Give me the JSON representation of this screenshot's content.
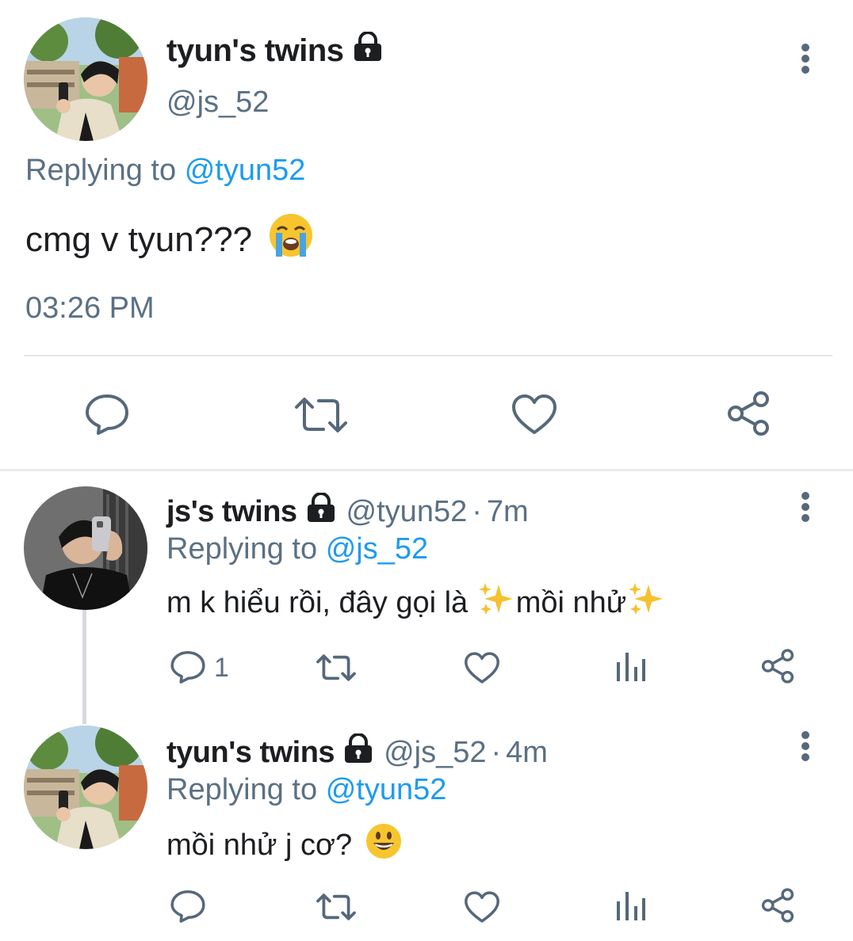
{
  "main_tweet": {
    "name": "tyun's twins",
    "handle": "@js_52",
    "replying_prefix": "Replying to",
    "replying_to": "@tyun52",
    "text": "cmg v tyun???",
    "emoji": "loudly-crying-face",
    "time": "03:26 PM"
  },
  "replies": [
    {
      "name": "js's twins",
      "handle": "@tyun52",
      "separator": "·",
      "age": "7m",
      "replying_prefix": "Replying to",
      "replying_to": "@js_52",
      "text_part1": "m k hiểu rồi, đây gọi là ",
      "text_part2": "mồi nhử",
      "reply_count": "1"
    },
    {
      "name": "tyun's twins",
      "handle": "@js_52",
      "separator": "·",
      "age": "4m",
      "replying_prefix": "Replying to",
      "replying_to": "@tyun52",
      "text": "mồi nhử j cơ?",
      "emoji": "grinning-face"
    }
  ],
  "colors": {
    "accent": "#1d9bf0",
    "secondary_text": "#5b7083",
    "icon": "#56687a"
  }
}
